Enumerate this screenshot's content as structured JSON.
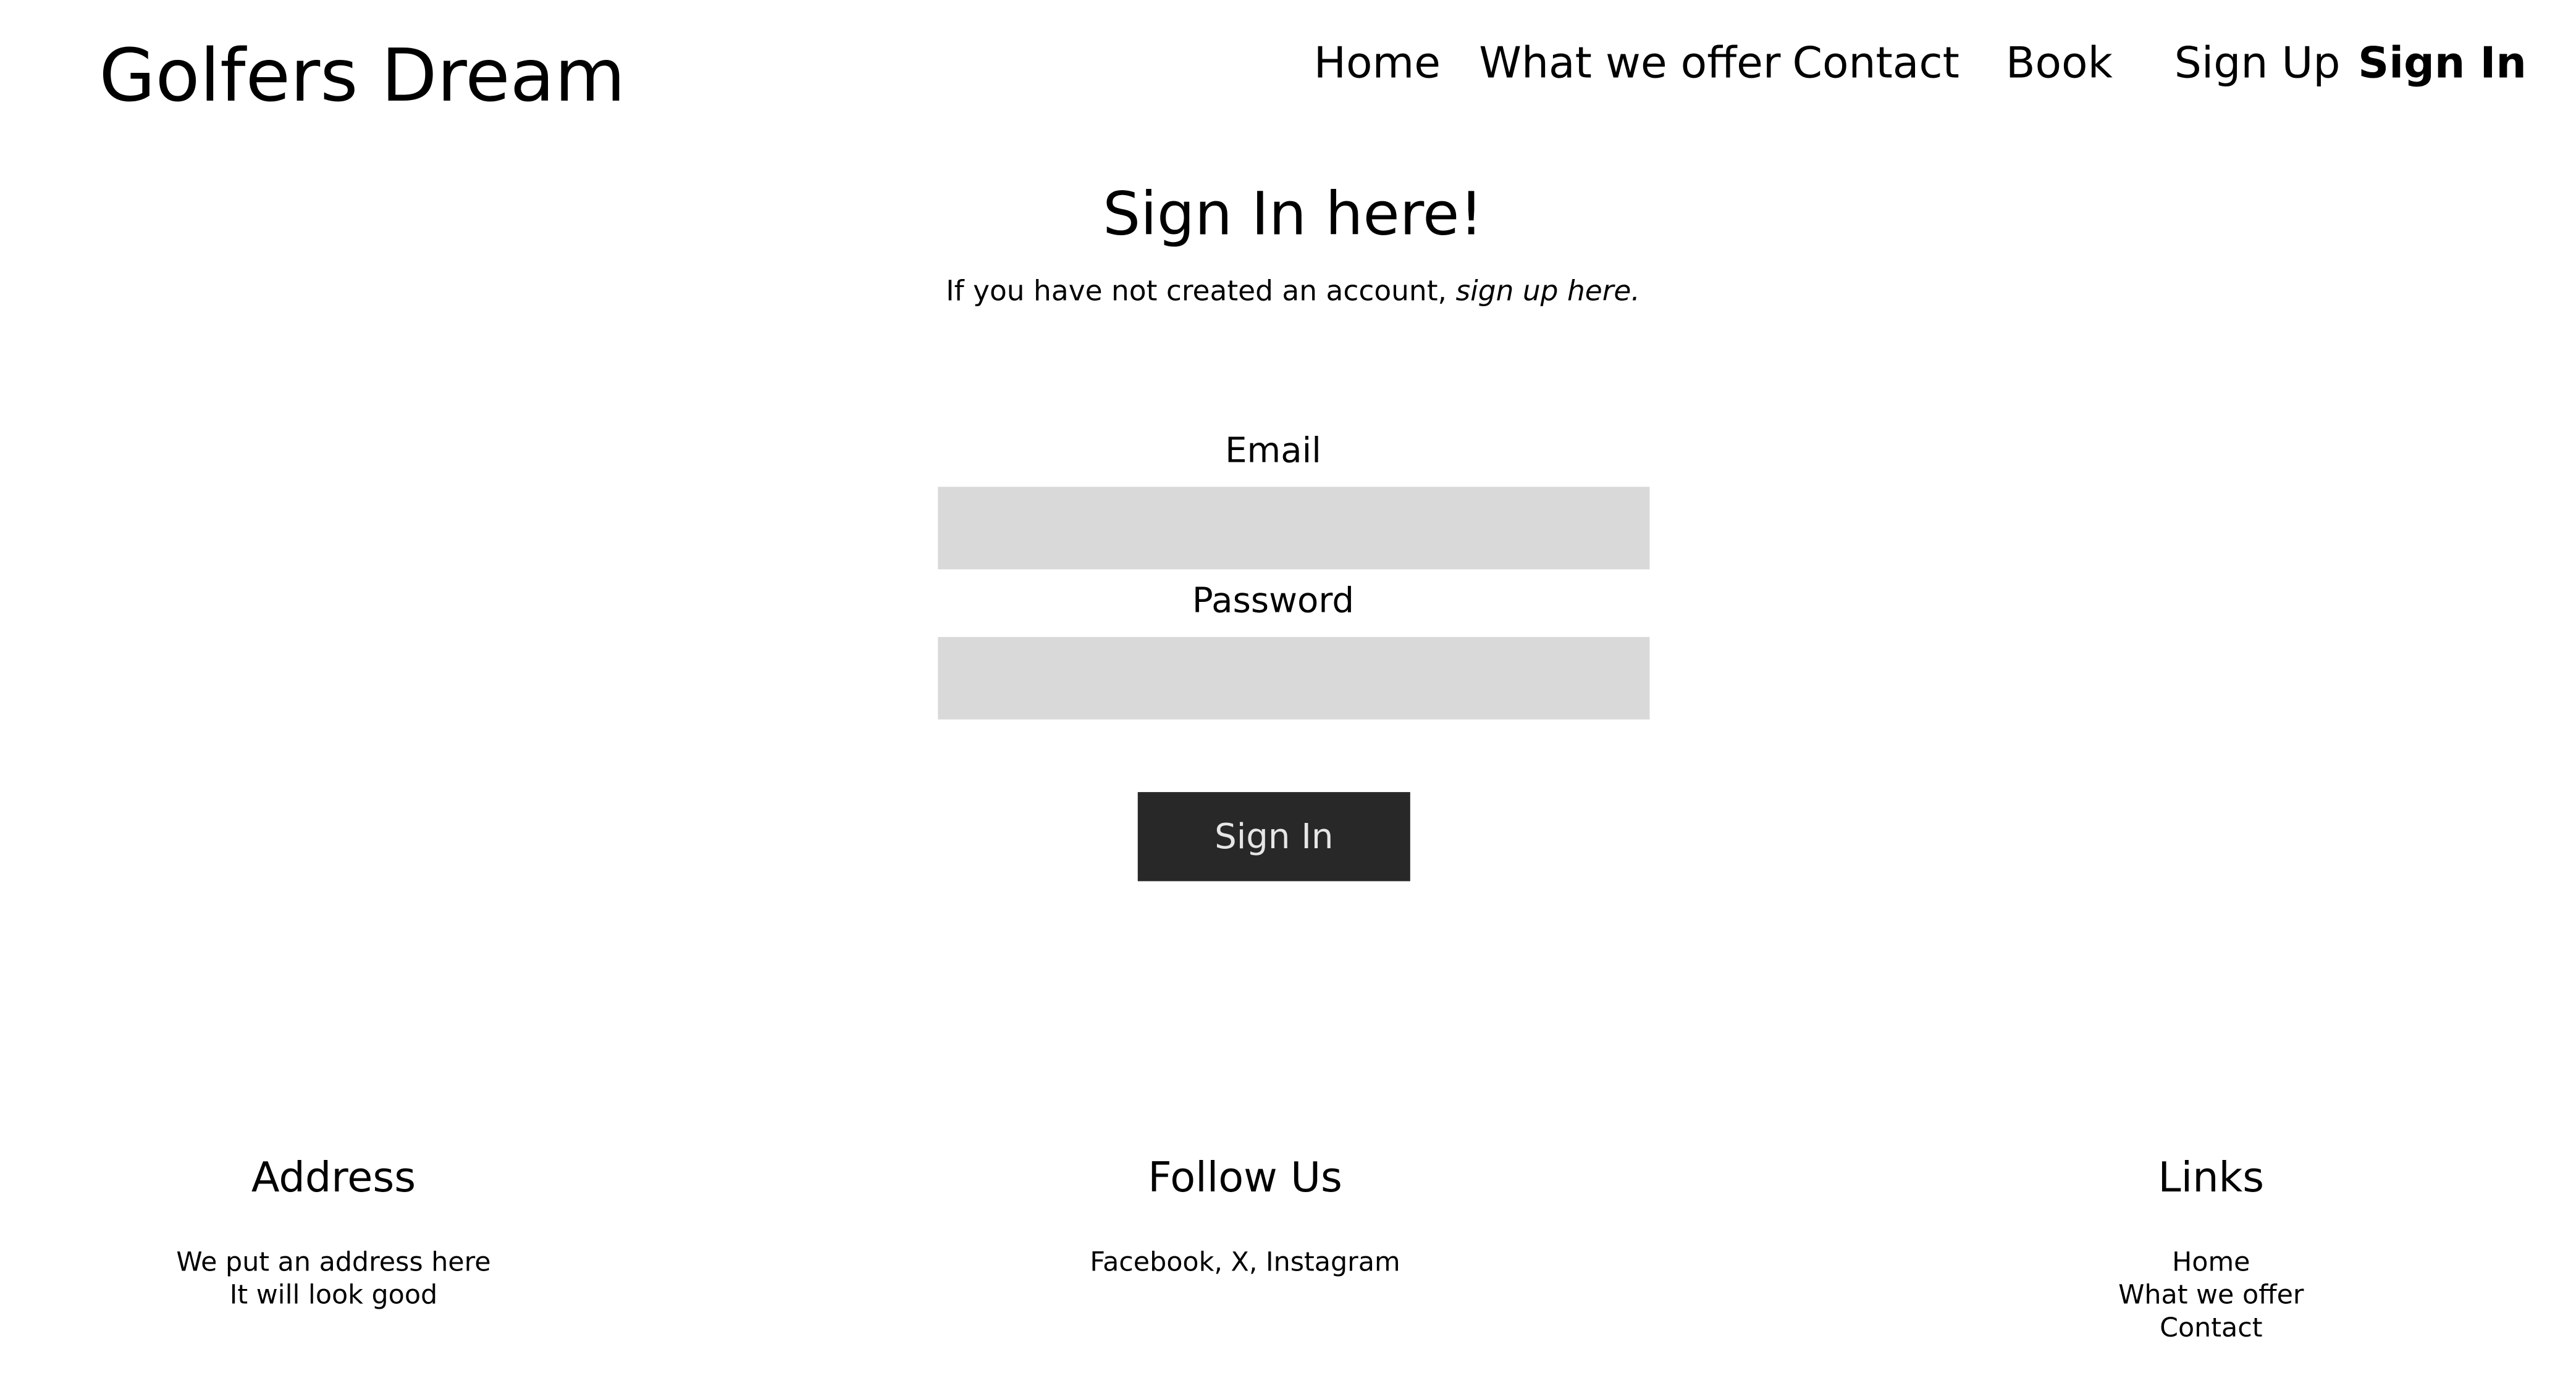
{
  "header": {
    "brand": "Golfers Dream",
    "nav": [
      {
        "label": "Home",
        "active": false
      },
      {
        "label": "What we offer",
        "active": false
      },
      {
        "label": "Contact",
        "active": false
      },
      {
        "label": "Book",
        "active": false
      },
      {
        "label": "Sign Up",
        "active": false
      },
      {
        "label": "Sign In",
        "active": true
      }
    ]
  },
  "main": {
    "title": "Sign In here!",
    "subtitle_prefix": "If you have not created an account, ",
    "subtitle_link": "sign up here.",
    "form": {
      "email_label": "Email",
      "email_value": "",
      "password_label": "Password",
      "password_value": "",
      "submit_label": "Sign In"
    }
  },
  "footer": {
    "address": {
      "heading": "Address",
      "lines": [
        "We put an address here",
        "It will look good"
      ]
    },
    "follow": {
      "heading": "Follow Us",
      "text": "Facebook, X, Instagram"
    },
    "links": {
      "heading": "Links",
      "items": [
        "Home",
        "What we offer",
        "Contact"
      ]
    }
  },
  "colors": {
    "background": "#ffffff",
    "text": "#000000",
    "input_background": "#d9d9d9",
    "button_background": "#282828",
    "button_text": "#e6e6e6"
  }
}
